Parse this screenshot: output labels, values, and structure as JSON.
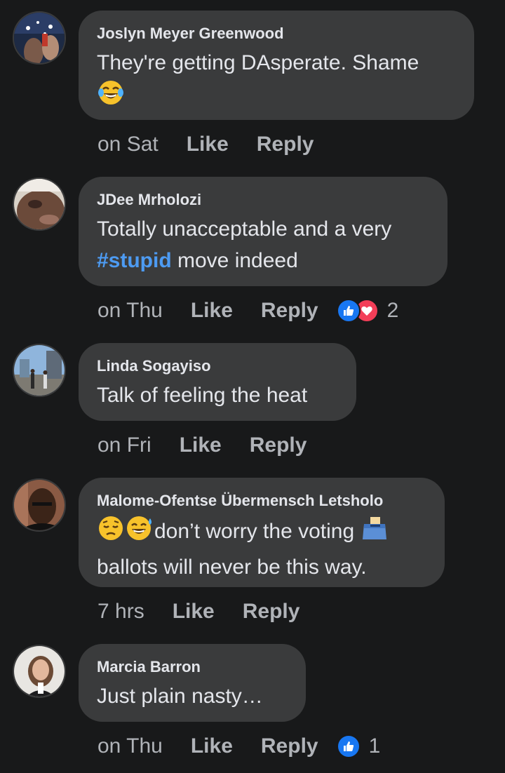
{
  "comments": [
    {
      "author": "Joslyn Meyer Greenwood",
      "text": "They're getting DAsperate. Shame",
      "time": "on Sat",
      "like": "Like",
      "reply": "Reply"
    },
    {
      "author": "JDee Mrholozi",
      "text_before": "Totally unacceptable and a very",
      "hashtag": "#stupid",
      "text_after": " move indeed",
      "time": "on Thu",
      "like": "Like",
      "reply": "Reply",
      "reaction_count": "2"
    },
    {
      "author": "Linda Sogayiso",
      "text": "Talk of feeling the heat",
      "time": "on Fri",
      "like": "Like",
      "reply": "Reply"
    },
    {
      "author": "Malome-Ofentse Übermensch Letsholo",
      "text_line1": "don’t worry the voting",
      "text_line2": "ballots will never be this way.",
      "time": "7 hrs",
      "like": "Like",
      "reply": "Reply"
    },
    {
      "author": "Marcia Barron",
      "text": "Just plain nasty…",
      "time": "on Thu",
      "like": "Like",
      "reply": "Reply",
      "reaction_count": "1"
    }
  ],
  "colors": {
    "background": "#18191a",
    "bubble": "#3a3b3c",
    "secondary_text": "#b0b3b8",
    "hashtag": "#4d9bf2",
    "like_reaction": "#1877f2",
    "love_reaction": "#f33e58"
  },
  "icons": [
    "laughing-tears-emoji",
    "pensive-emoji",
    "sweat-smile-emoji",
    "ballot-box-emoji",
    "like-reaction-icon",
    "love-reaction-icon"
  ]
}
